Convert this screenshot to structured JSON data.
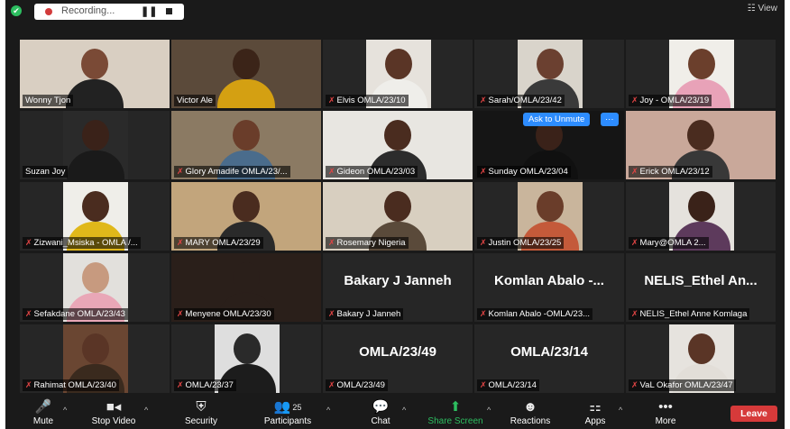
{
  "window": {
    "recording_label": "Recording...",
    "pause_icon": "pause-icon",
    "stop_icon": "stop-icon",
    "view_label": "View"
  },
  "participants": [
    {
      "name": "Wonny Tjon",
      "muted": false,
      "active": true,
      "video": true,
      "bg": "#d9cfc2",
      "skin": "#7a4a36",
      "shirt": "#222222"
    },
    {
      "name": "Victor Ale",
      "muted": false,
      "video": true,
      "bg": "#5b4a3a",
      "skin": "#3b2418",
      "shirt": "#d4a012"
    },
    {
      "name": "Elvis OMLA/23/10",
      "muted": true,
      "video": true,
      "bg": "#e6e2dc",
      "skin": "#5a3526",
      "shirt": "#efeeea"
    },
    {
      "name": "Sarah/OMLA/23/42",
      "muted": true,
      "video": true,
      "bg": "#d9d4cb",
      "skin": "#6b4030",
      "shirt": "#3a3a3a"
    },
    {
      "name": "Joy - OMLA/23/19",
      "muted": true,
      "video": true,
      "bg": "#f0eee9",
      "skin": "#6b3f2c",
      "shirt": "#e8a2b8"
    },
    {
      "name": "Suzan Joy",
      "muted": false,
      "video": true,
      "bg": "#2a2a2a",
      "skin": "#3a2219",
      "shirt": "#1a1a1a"
    },
    {
      "name": "Glory Amadife OMLA/23/...",
      "muted": true,
      "video": true,
      "bg": "#8b7a63",
      "skin": "#6a3d2a",
      "shirt": "#4a6c8c"
    },
    {
      "name": "Gideon OMLA/23/03",
      "muted": true,
      "video": true,
      "bg": "#e8e6e1",
      "skin": "#4a2c1f",
      "shirt": "#2c2c2c"
    },
    {
      "name": "Sunday OMLA/23/04",
      "muted": true,
      "video": true,
      "bg": "#151515",
      "skin": "#3a2219",
      "shirt": "#101010",
      "unmute_label": "Ask to Unmute",
      "more_label": "···"
    },
    {
      "name": "Erick OMLA/23/12",
      "muted": true,
      "video": true,
      "bg": "#c9a89a",
      "skin": "#4a2c1f",
      "shirt": "#383838"
    },
    {
      "name": "Zizwani_Msiska - OMLA /...",
      "muted": true,
      "video": true,
      "bg": "#efeee9",
      "skin": "#4a2c1f",
      "shirt": "#e0b81a"
    },
    {
      "name": "MARY OMLA/23/29",
      "muted": true,
      "video": true,
      "bg": "#c2a57c",
      "skin": "#4a2c1f",
      "shirt": "#2a2a2a"
    },
    {
      "name": "Rosemary Nigeria",
      "muted": true,
      "video": true,
      "bg": "#d8cfc0",
      "skin": "#4a2c1f",
      "shirt": "#5a4a3a"
    },
    {
      "name": "Justin OMLA/23/25",
      "muted": true,
      "video": true,
      "bg": "#c9b59c",
      "skin": "#6a3d2a",
      "shirt": "#c45a3a"
    },
    {
      "name": "Mary@OMLA 2...",
      "muted": true,
      "video": true,
      "bg": "#e5e2dd",
      "skin": "#3a2219",
      "shirt": "#5d3a5c"
    },
    {
      "name": "Sefakdane OMLA/23/43",
      "muted": true,
      "video": true,
      "bg": "#e2e0dc",
      "skin": "#c79a7f",
      "shirt": "#e9a7b7"
    },
    {
      "name": "Menyene OMLA/23/30",
      "muted": true,
      "video": true,
      "bg": "#2a1f1a",
      "skin": "#2a1f1a",
      "shirt": "#2a1f1a"
    },
    {
      "name": "Bakary J Janneh",
      "muted": true,
      "video": false,
      "display": "Bakary J Janneh"
    },
    {
      "name": "Komlan Abalo -OMLA/23...",
      "muted": true,
      "video": false,
      "display": "Komlan Abalo -..."
    },
    {
      "name": "NELIS_Ethel Anne Komlaga",
      "muted": true,
      "video": false,
      "display": "NELIS_Ethel An..."
    },
    {
      "name": "Rahimat OMLA/23/40",
      "muted": true,
      "video": true,
      "bg": "#6a4632",
      "skin": "#5a3526",
      "shirt": "#3a2a1e"
    },
    {
      "name": "OMLA/23/37",
      "muted": true,
      "video": true,
      "bg": "#dedede",
      "skin": "#2a2a2a",
      "shirt": "#1c1c1c"
    },
    {
      "name": "OMLA/23/49",
      "muted": true,
      "video": false,
      "display": "OMLA/23/49"
    },
    {
      "name": "OMLA/23/14",
      "muted": true,
      "video": false,
      "display": "OMLA/23/14"
    },
    {
      "name": "VaL Okafor OMLA/23/47",
      "muted": true,
      "video": true,
      "bg": "#e6e3de",
      "skin": "#5a3526",
      "shirt": "#e2ded8"
    }
  ],
  "toolbar": {
    "mute": {
      "label": "Mute",
      "icon": "microphone-icon"
    },
    "video": {
      "label": "Stop Video",
      "icon": "video-camera-icon"
    },
    "security": {
      "label": "Security",
      "icon": "shield-icon"
    },
    "participants": {
      "label": "Participants",
      "icon": "people-icon",
      "count": "25"
    },
    "chat": {
      "label": "Chat",
      "icon": "chat-icon"
    },
    "share": {
      "label": "Share Screen",
      "icon": "share-screen-icon"
    },
    "reactions": {
      "label": "Reactions",
      "icon": "reactions-icon"
    },
    "apps": {
      "label": "Apps",
      "icon": "apps-icon"
    },
    "more": {
      "label": "More",
      "icon": "more-icon"
    },
    "leave": {
      "label": "Leave"
    }
  },
  "colors": {
    "active_speaker": "#c9d943",
    "share_green": "#2dbe60",
    "leave_red": "#d63a3a",
    "ask_unmute_blue": "#2d8cff"
  }
}
